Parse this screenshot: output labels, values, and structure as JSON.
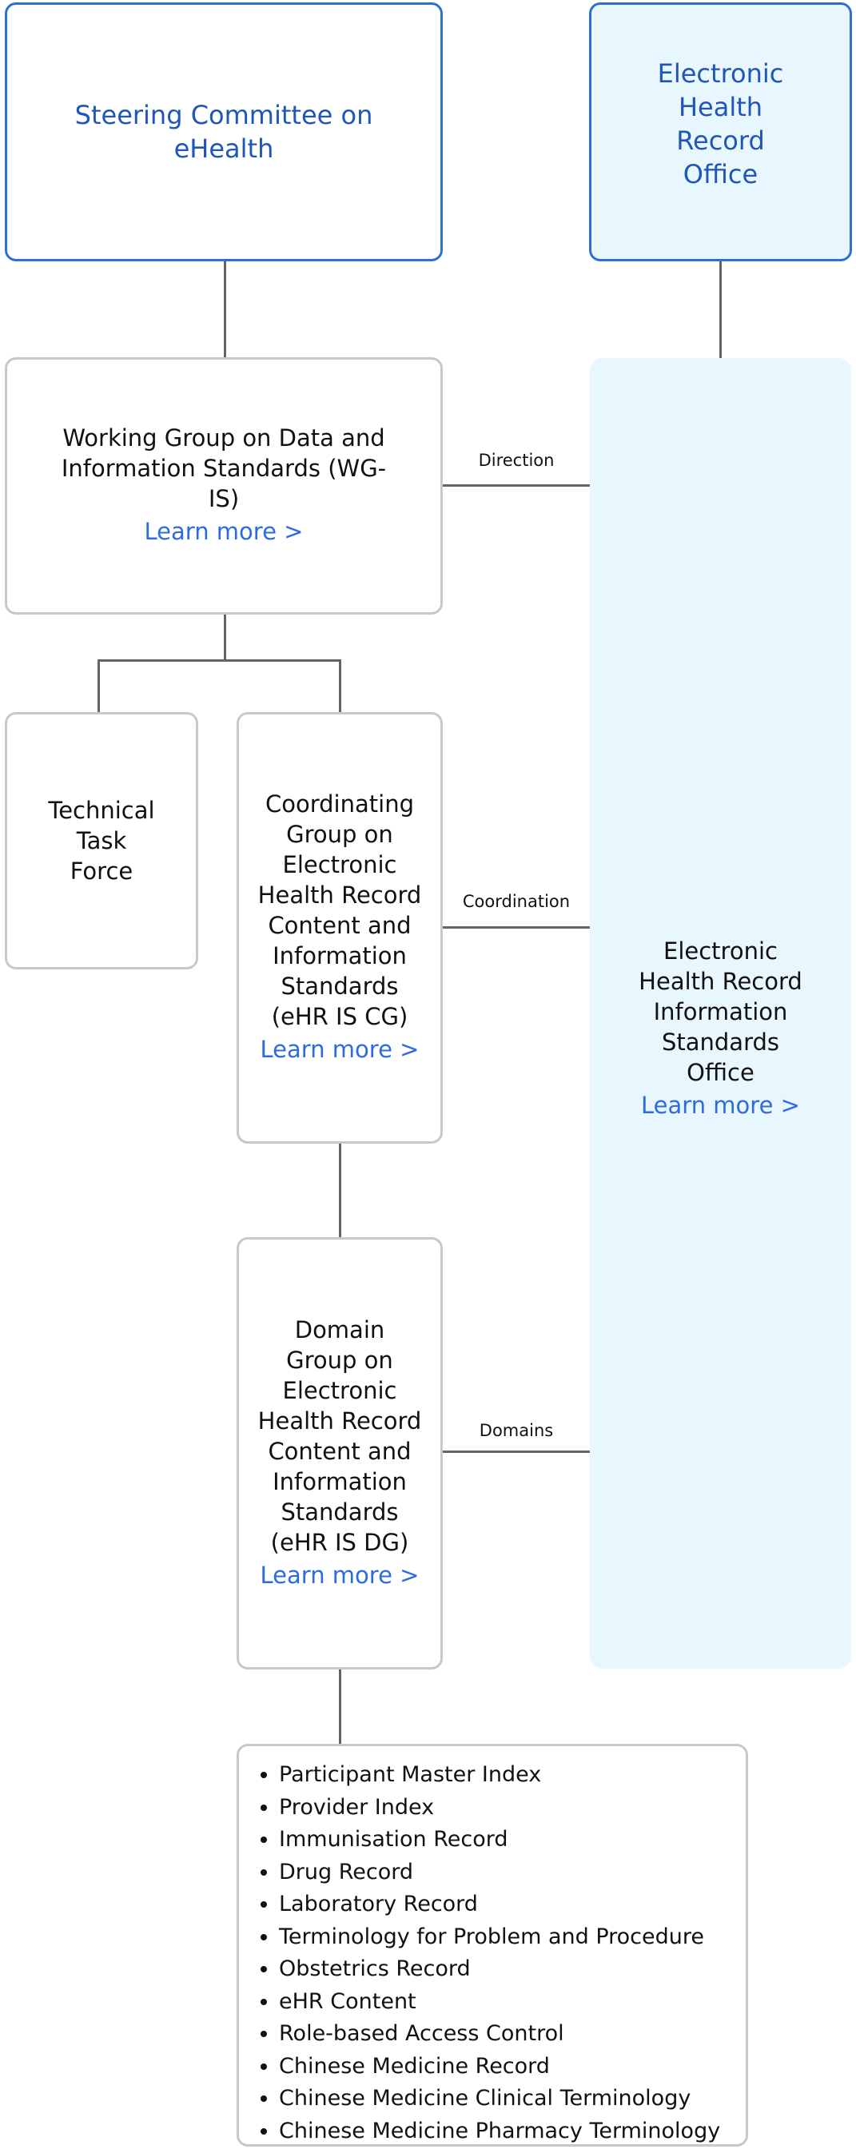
{
  "nodes": {
    "steering": {
      "title": "Steering Committee on eHealth"
    },
    "ehr_office": {
      "title": "Electronic Health Record Office"
    },
    "wg_is": {
      "title": "Working Group on Data and Information Standards (WG-IS)",
      "link": "Learn more >"
    },
    "technical": {
      "title": "Technical Task Force"
    },
    "cg": {
      "title": "Coordinating Group on Electronic Health Record Content and Information Standards (eHR IS CG)",
      "link": "Learn more >"
    },
    "dg": {
      "title": "Domain Group on Electronic Health Record Content and Information Standards (eHR IS DG)",
      "link": "Learn more >"
    },
    "ehr_iso": {
      "title": "Electronic Health Record Information Standards Office",
      "link": "Learn more >"
    }
  },
  "connectors": {
    "direction": "Direction",
    "coordination": "Coordination",
    "domains": "Domains"
  },
  "domains_list": [
    "Participant Master Index",
    "Provider Index",
    "Immunisation Record",
    "Drug Record",
    "Laboratory Record",
    "Terminology for Problem and Procedure",
    "Obstetrics Record",
    "eHR Content",
    "Role-based Access Control",
    "Chinese Medicine Record",
    "Chinese Medicine Clinical Terminology",
    "Chinese Medicine Pharmacy Terminology"
  ],
  "colors": {
    "accent_blue": "#2f6fd3",
    "link_blue": "#2d6be0",
    "panel_bg": "#e8f6fd",
    "box_border": "#c8c8c8",
    "line": "#646464"
  }
}
